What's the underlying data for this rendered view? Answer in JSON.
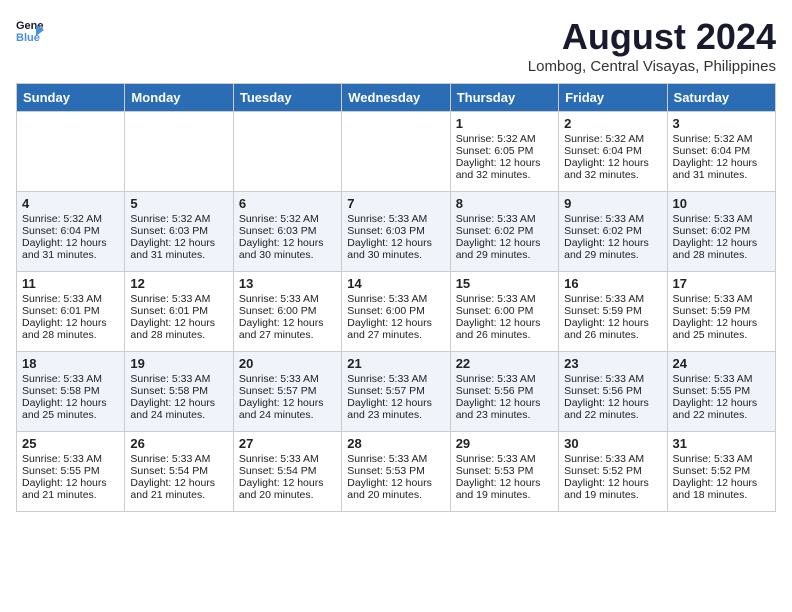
{
  "header": {
    "logo_line1": "General",
    "logo_line2": "Blue",
    "title": "August 2024",
    "subtitle": "Lombog, Central Visayas, Philippines"
  },
  "days_of_week": [
    "Sunday",
    "Monday",
    "Tuesday",
    "Wednesday",
    "Thursday",
    "Friday",
    "Saturday"
  ],
  "weeks": [
    [
      {
        "day": "",
        "info": ""
      },
      {
        "day": "",
        "info": ""
      },
      {
        "day": "",
        "info": ""
      },
      {
        "day": "",
        "info": ""
      },
      {
        "day": "1",
        "info": "Sunrise: 5:32 AM\nSunset: 6:05 PM\nDaylight: 12 hours\nand 32 minutes."
      },
      {
        "day": "2",
        "info": "Sunrise: 5:32 AM\nSunset: 6:04 PM\nDaylight: 12 hours\nand 32 minutes."
      },
      {
        "day": "3",
        "info": "Sunrise: 5:32 AM\nSunset: 6:04 PM\nDaylight: 12 hours\nand 31 minutes."
      }
    ],
    [
      {
        "day": "4",
        "info": "Sunrise: 5:32 AM\nSunset: 6:04 PM\nDaylight: 12 hours\nand 31 minutes."
      },
      {
        "day": "5",
        "info": "Sunrise: 5:32 AM\nSunset: 6:03 PM\nDaylight: 12 hours\nand 31 minutes."
      },
      {
        "day": "6",
        "info": "Sunrise: 5:32 AM\nSunset: 6:03 PM\nDaylight: 12 hours\nand 30 minutes."
      },
      {
        "day": "7",
        "info": "Sunrise: 5:33 AM\nSunset: 6:03 PM\nDaylight: 12 hours\nand 30 minutes."
      },
      {
        "day": "8",
        "info": "Sunrise: 5:33 AM\nSunset: 6:02 PM\nDaylight: 12 hours\nand 29 minutes."
      },
      {
        "day": "9",
        "info": "Sunrise: 5:33 AM\nSunset: 6:02 PM\nDaylight: 12 hours\nand 29 minutes."
      },
      {
        "day": "10",
        "info": "Sunrise: 5:33 AM\nSunset: 6:02 PM\nDaylight: 12 hours\nand 28 minutes."
      }
    ],
    [
      {
        "day": "11",
        "info": "Sunrise: 5:33 AM\nSunset: 6:01 PM\nDaylight: 12 hours\nand 28 minutes."
      },
      {
        "day": "12",
        "info": "Sunrise: 5:33 AM\nSunset: 6:01 PM\nDaylight: 12 hours\nand 28 minutes."
      },
      {
        "day": "13",
        "info": "Sunrise: 5:33 AM\nSunset: 6:00 PM\nDaylight: 12 hours\nand 27 minutes."
      },
      {
        "day": "14",
        "info": "Sunrise: 5:33 AM\nSunset: 6:00 PM\nDaylight: 12 hours\nand 27 minutes."
      },
      {
        "day": "15",
        "info": "Sunrise: 5:33 AM\nSunset: 6:00 PM\nDaylight: 12 hours\nand 26 minutes."
      },
      {
        "day": "16",
        "info": "Sunrise: 5:33 AM\nSunset: 5:59 PM\nDaylight: 12 hours\nand 26 minutes."
      },
      {
        "day": "17",
        "info": "Sunrise: 5:33 AM\nSunset: 5:59 PM\nDaylight: 12 hours\nand 25 minutes."
      }
    ],
    [
      {
        "day": "18",
        "info": "Sunrise: 5:33 AM\nSunset: 5:58 PM\nDaylight: 12 hours\nand 25 minutes."
      },
      {
        "day": "19",
        "info": "Sunrise: 5:33 AM\nSunset: 5:58 PM\nDaylight: 12 hours\nand 24 minutes."
      },
      {
        "day": "20",
        "info": "Sunrise: 5:33 AM\nSunset: 5:57 PM\nDaylight: 12 hours\nand 24 minutes."
      },
      {
        "day": "21",
        "info": "Sunrise: 5:33 AM\nSunset: 5:57 PM\nDaylight: 12 hours\nand 23 minutes."
      },
      {
        "day": "22",
        "info": "Sunrise: 5:33 AM\nSunset: 5:56 PM\nDaylight: 12 hours\nand 23 minutes."
      },
      {
        "day": "23",
        "info": "Sunrise: 5:33 AM\nSunset: 5:56 PM\nDaylight: 12 hours\nand 22 minutes."
      },
      {
        "day": "24",
        "info": "Sunrise: 5:33 AM\nSunset: 5:55 PM\nDaylight: 12 hours\nand 22 minutes."
      }
    ],
    [
      {
        "day": "25",
        "info": "Sunrise: 5:33 AM\nSunset: 5:55 PM\nDaylight: 12 hours\nand 21 minutes."
      },
      {
        "day": "26",
        "info": "Sunrise: 5:33 AM\nSunset: 5:54 PM\nDaylight: 12 hours\nand 21 minutes."
      },
      {
        "day": "27",
        "info": "Sunrise: 5:33 AM\nSunset: 5:54 PM\nDaylight: 12 hours\nand 20 minutes."
      },
      {
        "day": "28",
        "info": "Sunrise: 5:33 AM\nSunset: 5:53 PM\nDaylight: 12 hours\nand 20 minutes."
      },
      {
        "day": "29",
        "info": "Sunrise: 5:33 AM\nSunset: 5:53 PM\nDaylight: 12 hours\nand 19 minutes."
      },
      {
        "day": "30",
        "info": "Sunrise: 5:33 AM\nSunset: 5:52 PM\nDaylight: 12 hours\nand 19 minutes."
      },
      {
        "day": "31",
        "info": "Sunrise: 5:33 AM\nSunset: 5:52 PM\nDaylight: 12 hours\nand 18 minutes."
      }
    ]
  ]
}
